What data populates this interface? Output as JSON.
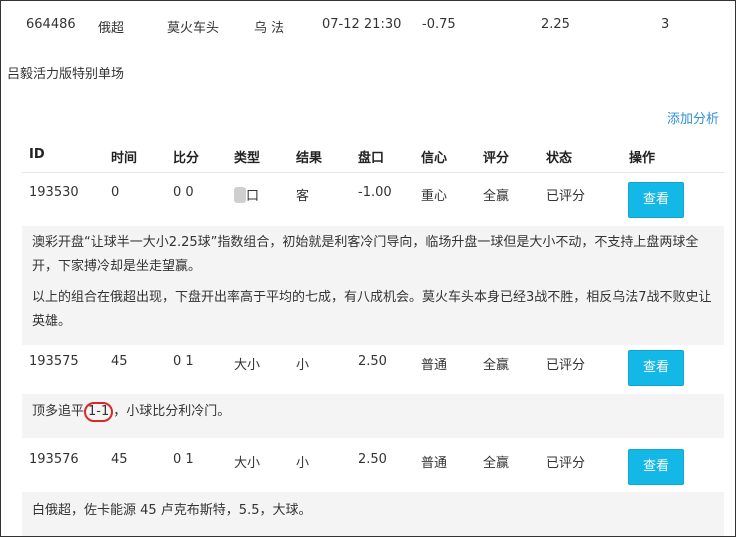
{
  "top_row": {
    "id": "664486",
    "league": "俄超",
    "home": "莫火车头",
    "away": "乌 法",
    "time": "07-12 21:30",
    "handicap": "-0.75",
    "total": "2.25",
    "count": "3"
  },
  "section": {
    "title": "吕毅活力版特别单场",
    "add_label": "添加分析"
  },
  "headers": {
    "id": "ID",
    "time": "时间",
    "score": "比分",
    "type": "类型",
    "result": "结果",
    "line": "盘口",
    "confidence": "信心",
    "rating": "评分",
    "status": "状态",
    "action": "操作"
  },
  "rows": [
    {
      "id": "193530",
      "time": "0",
      "score": "0 0",
      "type": "",
      "result": "客",
      "line": "-1.00",
      "confidence": "重心",
      "rating": "全赢",
      "status": "已评分",
      "action": "查看"
    },
    {
      "id": "193575",
      "time": "45",
      "score": "0 1",
      "type": "大小",
      "result": "小",
      "line": "2.50",
      "confidence": "普通",
      "rating": "全赢",
      "status": "已评分",
      "action": "查看"
    },
    {
      "id": "193576",
      "time": "45",
      "score": "0 1",
      "type": "大小",
      "result": "小",
      "line": "2.50",
      "confidence": "普通",
      "rating": "全赢",
      "status": "已评分",
      "action": "查看"
    }
  ],
  "row1_type_visible": "口",
  "analysis": {
    "a1_p1": "澳彩开盘“让球半一大小2.25球”指数组合，初始就是利客冷门导向，临场升盘一球但是大小不动，不支持上盘两球全开，下家搏冷却是坐走望赢。",
    "a1_p2": "以上的组合在俄超出现，下盘开出率高于平均的七成，有八成机会。莫火车头本身已经3战不胜，相反乌法7战不败史让英雄。",
    "a2_pre": "顶多追平",
    "a2_circled": "1-1",
    "a2_post": "，小球比分利冷门。",
    "a3": "白俄超，佐卡能源 45 卢克布斯特，5.5，大球。"
  },
  "colors": {
    "accent": "#14b8e7",
    "link": "#2d8fd6",
    "circle": "#d9282b"
  }
}
